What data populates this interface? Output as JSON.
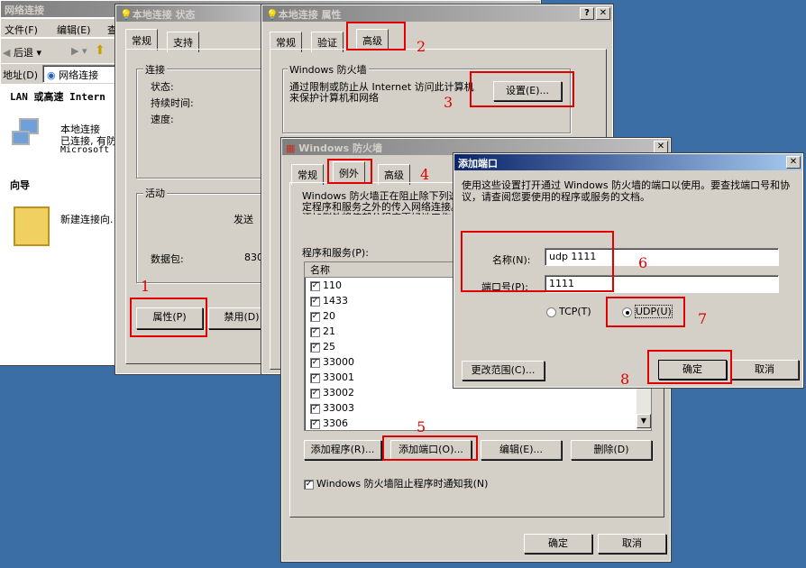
{
  "explorer": {
    "title": "网络连接",
    "menu": [
      "文件(F)",
      "编辑(E)",
      "查"
    ],
    "back_label": "后退",
    "address_label": "地址(D)",
    "address_value": "网络连接",
    "section_lan": "LAN 或高速 Intern",
    "conn_name": "本地连接",
    "conn_status": "已连接, 有防",
    "conn_device": "Microsoft I",
    "section_wizard": "向导",
    "wizard_item": "新建连接向."
  },
  "status_dialog": {
    "title": "本地连接 状态",
    "tabs": [
      "常规",
      "支持"
    ],
    "group_conn": "连接",
    "status_label": "状态:",
    "duration_label": "持续时间:",
    "speed_label": "速度:",
    "group_activity": "活动",
    "sent_label": "发送",
    "packets_label": "数据包:",
    "packets_value": "830",
    "properties_button": "属性(P)",
    "disable_button": "禁用(D)"
  },
  "props_dialog": {
    "title": "本地连接 属性",
    "tabs": [
      "常规",
      "验证",
      "高级"
    ],
    "group_firewall": "Windows 防火墙",
    "firewall_desc": "通过限制或防止从 Internet 访问此计算机来保护计算机和网络",
    "settings_button": "设置(E)..."
  },
  "firewall_dialog": {
    "title": "Windows 防火墙",
    "tabs": [
      "常规",
      "例外",
      "高级"
    ],
    "desc": "Windows 防火墙正在阻止除下列选定程序和服务之外的传入网络连接。添加例外将使部分程序更好地工作",
    "list_label": "程序和服务(P):",
    "list_header": "名称",
    "items": [
      "110",
      "1433",
      "20",
      "21",
      "25",
      "33000",
      "33001",
      "33002",
      "33003",
      "3306"
    ],
    "add_program_button": "添加程序(R)...",
    "add_port_button": "添加端口(O)...",
    "edit_button": "编辑(E)...",
    "delete_button": "删除(D)",
    "notify_label": "Windows 防火墙阻止程序时通知我(N)",
    "ok_button": "确定",
    "cancel_button": "取消"
  },
  "addport_dialog": {
    "title": "添加端口",
    "desc": "使用这些设置打开通过 Windows 防火墙的端口以使用。要查找端口号和协议，请查阅您要使用的程序或服务的文档。",
    "name_label": "名称(N):",
    "name_value": "udp 1111",
    "port_label": "端口号(P):",
    "port_value": "1111",
    "tcp_label": "TCP(T)",
    "udp_label": "UDP(U)",
    "change_scope_button": "更改范围(C)...",
    "ok_button": "确定",
    "cancel_button": "取消"
  },
  "annotations": [
    "1",
    "2",
    "3",
    "4",
    "5",
    "6",
    "7",
    "8"
  ],
  "colors": {
    "annotation": "#e00000",
    "desktop": "#3a6ea5",
    "dialog": "#d4d0c8"
  }
}
